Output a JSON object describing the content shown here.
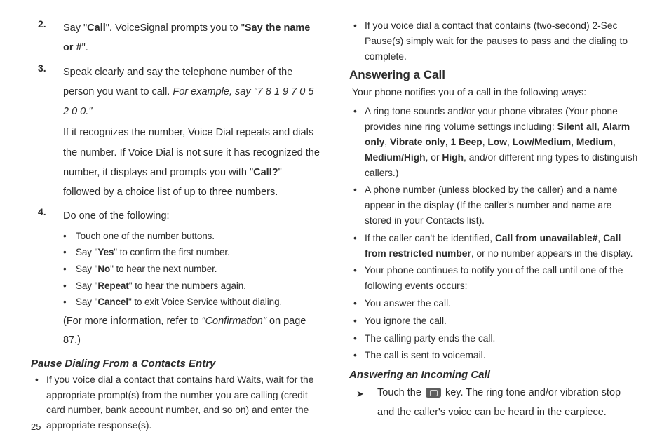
{
  "page_number": "25",
  "left": {
    "items": [
      {
        "num": "2.",
        "paras": [
          {
            "runs": [
              [
                "",
                "Say \""
              ],
              [
                "b",
                "Call"
              ],
              [
                "",
                "\". VoiceSignal prompts you to \""
              ],
              [
                "b",
                "Say the name or #"
              ],
              [
                "",
                "\"."
              ]
            ]
          }
        ]
      },
      {
        "num": "3.",
        "paras": [
          {
            "runs": [
              [
                "",
                "Speak clearly and say the telephone number of the person you want to call. "
              ],
              [
                "i",
                "For example, say \"7 8 1 9 7 0 5 2 0 0.\""
              ]
            ]
          },
          {
            "runs": [
              [
                "",
                "If it recognizes the number, Voice Dial repeats and dials the number. If Voice Dial is not sure it has recognized the number, it displays and prompts you with \""
              ],
              [
                "b",
                "Call?"
              ],
              [
                "",
                "\" followed by a choice list of up to three numbers."
              ]
            ]
          }
        ]
      },
      {
        "num": "4.",
        "paras": [
          {
            "runs": [
              [
                "",
                "Do one of the following:"
              ]
            ]
          }
        ],
        "subs": [
          {
            "runs": [
              [
                "",
                "Touch one of the number buttons."
              ]
            ]
          },
          {
            "runs": [
              [
                "",
                "Say \""
              ],
              [
                "b",
                "Yes"
              ],
              [
                "",
                "\" to confirm the first number."
              ]
            ]
          },
          {
            "runs": [
              [
                "",
                "Say \""
              ],
              [
                "b",
                "No"
              ],
              [
                "",
                "\" to hear the next number."
              ]
            ]
          },
          {
            "runs": [
              [
                "",
                "Say \""
              ],
              [
                "b",
                "Repeat"
              ],
              [
                "",
                "\" to hear the numbers again."
              ]
            ]
          },
          {
            "runs": [
              [
                "",
                "Say \""
              ],
              [
                "b",
                "Cancel"
              ],
              [
                "",
                "\" to exit Voice Service without dialing."
              ]
            ]
          }
        ],
        "after": [
          {
            "runs": [
              [
                "",
                "(For more information, refer to "
              ],
              [
                "i",
                "\"Confirmation\""
              ],
              [
                "",
                " on page 87.)"
              ]
            ]
          }
        ]
      }
    ],
    "h3": "Pause Dialing From a Contacts Entry",
    "pause_items": [
      {
        "runs": [
          [
            "",
            "If you voice dial a contact that contains hard Waits, wait for the appropriate prompt(s) from the number you are calling (credit card number, bank account number, and so on) and enter the appropriate response(s)."
          ]
        ]
      }
    ]
  },
  "right": {
    "top_items": [
      {
        "runs": [
          [
            "",
            "If you voice dial a contact that contains (two-second) 2-Sec Pause(s) simply wait for the pauses to pass and the dialing to complete."
          ]
        ]
      }
    ],
    "h2": "Answering a Call",
    "lead": "Your phone notifies you of a call in the following ways:",
    "items": [
      {
        "runs": [
          [
            "",
            "A ring tone sounds and/or your phone vibrates (Your phone provides nine ring volume settings including: "
          ],
          [
            "b",
            "Silent all"
          ],
          [
            "",
            ", "
          ],
          [
            "b",
            "Alarm only"
          ],
          [
            "",
            ", "
          ],
          [
            "b",
            "Vibrate only"
          ],
          [
            "",
            ", "
          ],
          [
            "b",
            "1 Beep"
          ],
          [
            "",
            ", "
          ],
          [
            "b",
            "Low"
          ],
          [
            "",
            ", "
          ],
          [
            "b",
            "Low/Medium"
          ],
          [
            "",
            ", "
          ],
          [
            "b",
            "Medium"
          ],
          [
            "",
            ", "
          ],
          [
            "b",
            "Medium/High"
          ],
          [
            "",
            ", or "
          ],
          [
            "b",
            "High"
          ],
          [
            "",
            ", and/or different ring types to distinguish callers.)"
          ]
        ]
      },
      {
        "runs": [
          [
            "",
            "A phone number (unless blocked by the caller) and a name appear in the display (If the caller's number and name are stored in your Contacts list)."
          ]
        ]
      },
      {
        "runs": [
          [
            "",
            "If the caller can't be identified, "
          ],
          [
            "b",
            "Call from unavailable#"
          ],
          [
            "",
            ", "
          ],
          [
            "b",
            "Call from restricted number"
          ],
          [
            "",
            ", or no number appears in the display."
          ]
        ]
      },
      {
        "runs": [
          [
            "",
            "Your phone continues to notify you of the call until one of the following events occurs:"
          ]
        ]
      },
      {
        "runs": [
          [
            "",
            "You answer the call."
          ]
        ]
      },
      {
        "runs": [
          [
            "",
            "You ignore the call."
          ]
        ]
      },
      {
        "runs": [
          [
            "",
            "The calling party ends the call."
          ]
        ]
      },
      {
        "runs": [
          [
            "",
            "The call is sent to voicemail."
          ]
        ]
      }
    ],
    "h3": "Answering an Incoming Call",
    "arrow": {
      "pre": "Touch the ",
      "post": " key. The ring tone and/or vibration stop and the caller's voice can be heard in the earpiece."
    }
  }
}
